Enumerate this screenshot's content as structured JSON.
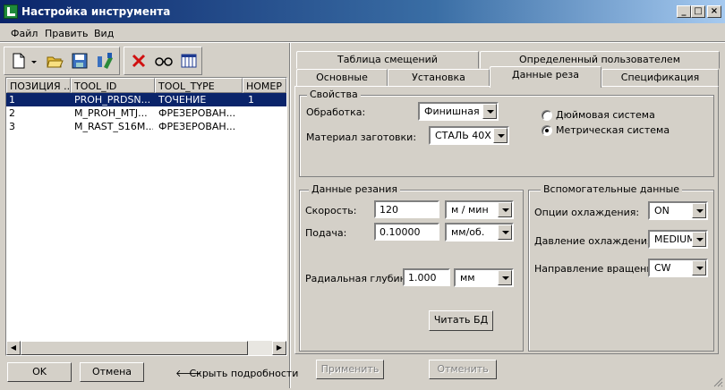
{
  "window": {
    "title": "Настройка инструмента",
    "min": "_",
    "max": "□",
    "close": "×"
  },
  "menu": [
    "Файл",
    "Править",
    "Вид"
  ],
  "list": {
    "columns": [
      "ПОЗИЦИЯ ...",
      "TOOL_ID",
      "TOOL_TYPE",
      "НОМЕР Н"
    ],
    "rows": [
      [
        "1",
        "PROH_PRDSN...",
        "ТОЧЕНИЕ",
        "1"
      ],
      [
        "2",
        "M_PROH_MTJ...",
        "ФРЕЗЕРОВАН...",
        ""
      ],
      [
        "3",
        "M_RAST_S16M...",
        "ФРЕЗЕРОВАН...",
        ""
      ]
    ]
  },
  "bottom": {
    "ok": "OK",
    "cancel": "Отмена",
    "hide_details": "Скрыть подробности"
  },
  "tabs": {
    "row_back": [
      "Таблица смещений",
      "Определенный пользователем"
    ],
    "row_front": [
      "Основные",
      "Установка",
      "Данные реза",
      "Спецификация"
    ],
    "active": "Данные реза"
  },
  "properties": {
    "group": "Свойства",
    "processing_label": "Обработка:",
    "processing_value": "Финишная",
    "material_label": "Материал заготовки:",
    "material_value": "СТАЛЬ 40Х",
    "unit_inch": "Дюймовая система",
    "unit_metric": "Метрическая система",
    "unit_selected": "metric"
  },
  "cutting": {
    "group": "Данные резания",
    "speed_label": "Скорость:",
    "speed_value": "120",
    "speed_unit": "м / мин",
    "feed_label": "Подача:",
    "feed_value": "0.10000",
    "feed_unit": "мм/об.",
    "radial_label": "Радиальная глубина:",
    "radial_value": "1.000",
    "radial_unit": "мм",
    "read_db": "Читать БД"
  },
  "aux": {
    "group": "Вспомогательные данные",
    "coolant_label": "Опции охлаждения:",
    "coolant_value": "ON",
    "pressure_label": "Давление охлаждения:",
    "pressure_value": "MEDIUM",
    "rotation_label": "Направление вращения:",
    "rotation_value": "CW"
  },
  "actions": {
    "apply": "Применить",
    "cancel": "Отменить"
  },
  "colors": {
    "selection": "#0a246a",
    "title_start": "#0a246a",
    "face": "#d4d0c8"
  }
}
